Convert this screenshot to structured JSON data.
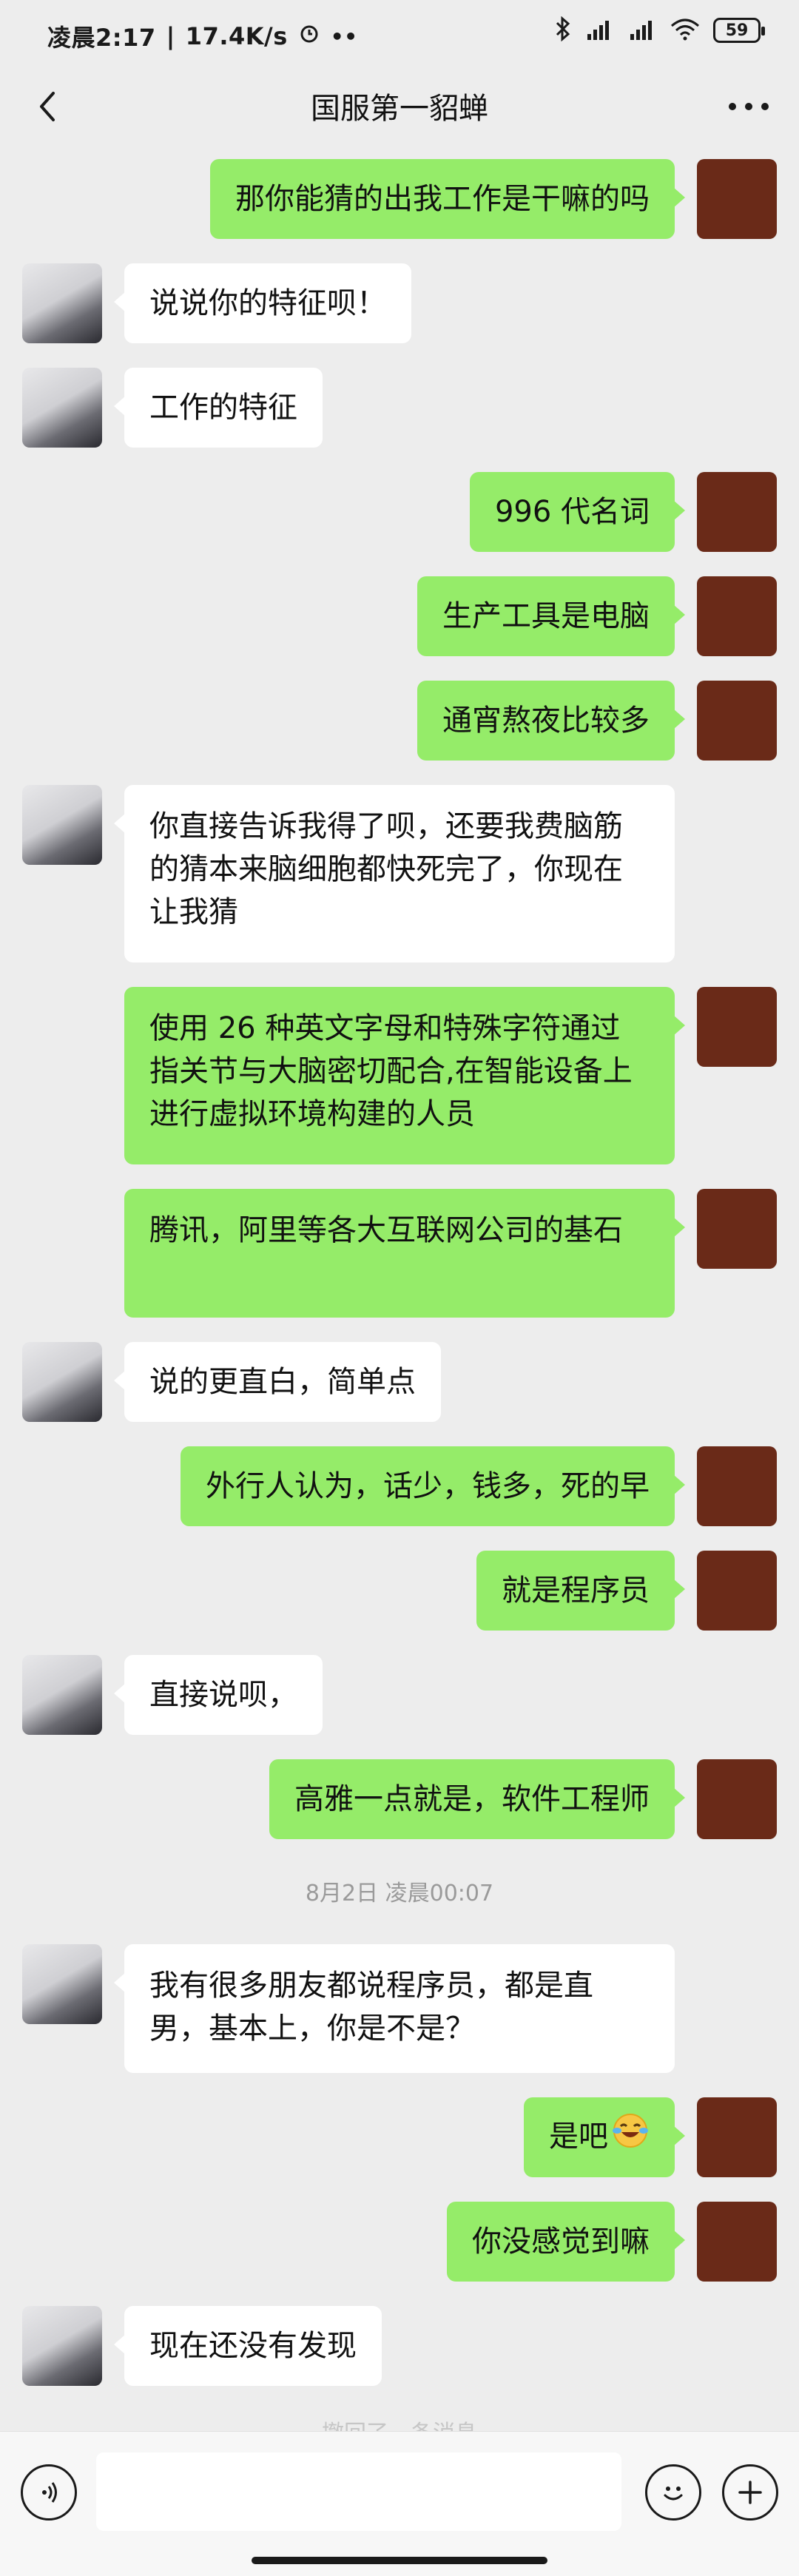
{
  "status_bar": {
    "time": "凌晨2:17",
    "network_speed": "17.4K/s",
    "battery": "59",
    "icons": [
      "alarm-icon",
      "more-dots-icon",
      "bluetooth-icon",
      "hd-signal-icon",
      "signal-icon",
      "wifi-icon",
      "battery-icon"
    ]
  },
  "header": {
    "title": "国服第一貂蝉",
    "back_icon": "chevron-left-icon",
    "more_icon": "more-horizontal-icon"
  },
  "messages": [
    {
      "side": "right",
      "text": "那你能猜的出我工作是干嘛的吗"
    },
    {
      "side": "left",
      "text": "说说你的特征呗！"
    },
    {
      "side": "left",
      "text": "工作的特征"
    },
    {
      "side": "right",
      "text": "996 代名词"
    },
    {
      "side": "right",
      "text": "生产工具是电脑"
    },
    {
      "side": "right",
      "text": "通宵熬夜比较多"
    },
    {
      "side": "left",
      "text": "你直接告诉我得了呗，还要我费脑筋的猜本来脑细胞都快死完了，你现在让我猜"
    },
    {
      "side": "right",
      "text": "使用 26 种英文字母和特殊字符通过指关节与大脑密切配合,在智能设备上进行虚拟环境构建的人员"
    },
    {
      "side": "right",
      "text": "腾讯，阿里等各大互联网公司的基石"
    },
    {
      "side": "left",
      "text": "说的更直白，简单点"
    },
    {
      "side": "right",
      "text": "外行人认为，话少，钱多，死的早"
    },
    {
      "side": "right",
      "text": "就是程序员"
    },
    {
      "side": "left",
      "text": "直接说呗，"
    },
    {
      "side": "right",
      "text": "高雅一点就是，软件工程师"
    },
    {
      "side": "left",
      "text": "我有很多朋友都说程序员，都是直男，基本上，你是不是？"
    },
    {
      "side": "right",
      "text": "是吧",
      "emoji": "laughing-crying-emoji"
    },
    {
      "side": "right",
      "text": "你没感觉到嘛"
    },
    {
      "side": "left",
      "text": "现在还没有发现"
    }
  ],
  "timestamp": "8月2日 凌晨00:07",
  "faded_notice": "撤回了一条消息",
  "input": {
    "voice_icon": "voice-icon",
    "emoji_icon": "emoji-icon",
    "plus_icon": "plus-icon",
    "value": "",
    "placeholder": ""
  }
}
